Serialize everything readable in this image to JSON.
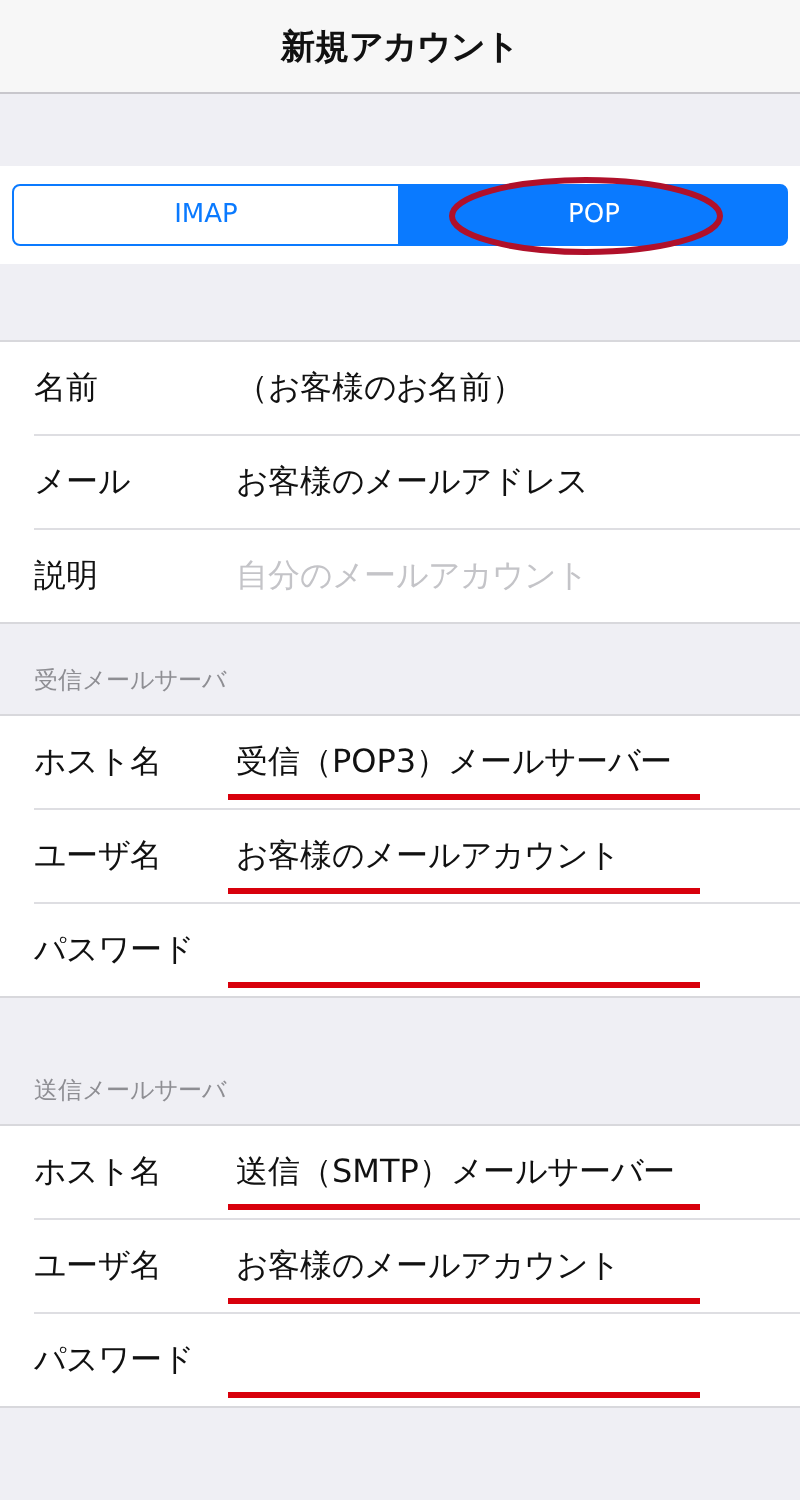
{
  "nav_bar": {
    "title": "新規アカウント"
  },
  "account_type": [
    {
      "label": "IMAP",
      "selected": false
    },
    {
      "label": "POP",
      "selected": true,
      "circled": true
    }
  ],
  "account": {
    "fields": [
      {
        "label": "名前",
        "value": "（お客様のお名前）"
      },
      {
        "label": "メール",
        "value": "お客様のメールアドレス"
      },
      {
        "label": "説明",
        "placeholder": "自分のメールアカウント"
      }
    ]
  },
  "incoming_server": {
    "header": "受信メールサーバ",
    "fields": [
      {
        "label": "ホスト名",
        "value": "受信（POP3）メールサーバー",
        "underlined": true
      },
      {
        "label": "ユーザ名",
        "value": "お客様のメールアカウント",
        "underlined": true
      },
      {
        "label": "パスワード",
        "underlined": true
      }
    ]
  },
  "outgoing_server": {
    "header": "送信メールサーバ",
    "fields": [
      {
        "label": "ホスト名",
        "value": "送信（SMTP）メールサーバー",
        "underlined": true
      },
      {
        "label": "ユーザ名",
        "value": "お客様のメールアカウント",
        "underlined": true
      },
      {
        "label": "パスワード",
        "underlined": true
      }
    ]
  }
}
